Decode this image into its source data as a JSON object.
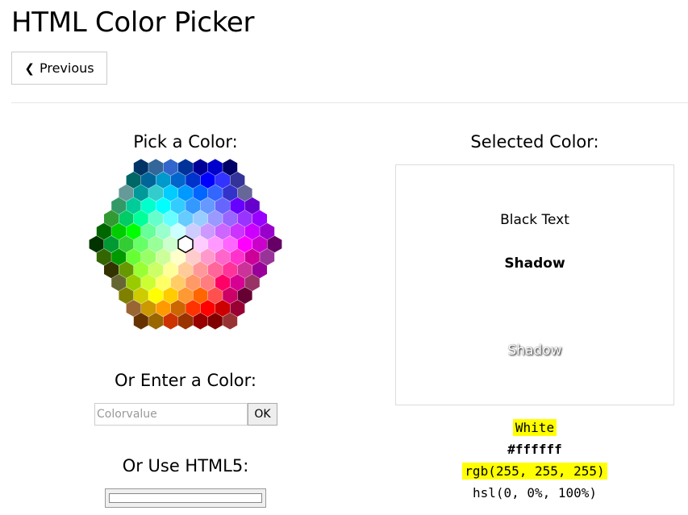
{
  "title": "HTML Color Picker",
  "nav": {
    "previous_label": "Previous"
  },
  "picker_section": {
    "heading": "Pick a Color:"
  },
  "enter_section": {
    "heading": "Or Enter a Color:",
    "placeholder": "Colorvalue",
    "ok_label": "OK"
  },
  "html5_section": {
    "heading": "Or Use HTML5:",
    "value": "#ffffff"
  },
  "selected_section": {
    "heading": "Selected Color:",
    "preview_bg": "#ffffff",
    "black_text": "Black Text",
    "shadow_label": "Shadow",
    "shadow_label_2": "Shadow"
  },
  "color_info": {
    "name": "White",
    "hex": "#ffffff",
    "rgb": "rgb(255, 255, 255)",
    "hsl": "hsl(0, 0%, 100%)",
    "highlight_color": "#ffff00"
  },
  "hex_palette": {
    "rows": [
      [
        "#003366",
        "#336699",
        "#3366CC",
        "#003399",
        "#000099",
        "#0000CC",
        "#000066"
      ],
      [
        "#006666",
        "#006699",
        "#0099CC",
        "#0066CC",
        "#0033CC",
        "#0000FF",
        "#3333FF",
        "#333399"
      ],
      [
        "#669999",
        "#009999",
        "#33CCCC",
        "#00CCFF",
        "#0099FF",
        "#0066FF",
        "#3366FF",
        "#3333CC",
        "#666699"
      ],
      [
        "#339966",
        "#00CC99",
        "#00FFCC",
        "#00FFFF",
        "#33CCFF",
        "#3399FF",
        "#6699FF",
        "#6666FF",
        "#6600FF",
        "#6600CC"
      ],
      [
        "#339933",
        "#00CC66",
        "#00FF99",
        "#66FFCC",
        "#66FFFF",
        "#66CCFF",
        "#99CCFF",
        "#9999FF",
        "#9966FF",
        "#9933FF",
        "#9900FF"
      ],
      [
        "#006600",
        "#00CC00",
        "#00FF00",
        "#66FF99",
        "#99FFCC",
        "#CCFFFF",
        "#CCCCFF",
        "#CC99FF",
        "#CC66FF",
        "#CC33FF",
        "#CC00FF",
        "#9900CC"
      ],
      [
        "#003300",
        "#009933",
        "#33CC33",
        "#66FF66",
        "#99FF99",
        "#CCFFCC",
        "#FFFFFF",
        "#FFCCFF",
        "#FF99FF",
        "#FF66FF",
        "#FF00FF",
        "#CC00CC",
        "#660066"
      ],
      [
        "#336600",
        "#009900",
        "#66FF33",
        "#99FF66",
        "#CCFF99",
        "#FFFFCC",
        "#FFCCCC",
        "#FF99CC",
        "#FF66CC",
        "#FF33CC",
        "#CC0099",
        "#993399"
      ],
      [
        "#333300",
        "#669900",
        "#99FF33",
        "#CCFF66",
        "#FFFF99",
        "#FFCC99",
        "#FF9999",
        "#FF6699",
        "#FF3399",
        "#CC3399",
        "#990099"
      ],
      [
        "#666633",
        "#99CC00",
        "#CCFF33",
        "#FFFF66",
        "#FFCC66",
        "#FF9966",
        "#FF7C80",
        "#FF0066",
        "#D60093",
        "#993366"
      ],
      [
        "#808000",
        "#CCCC00",
        "#FFFF00",
        "#FFCC00",
        "#FF9933",
        "#FF6600",
        "#FF5050",
        "#CC0066",
        "#660033"
      ],
      [
        "#996633",
        "#CC9900",
        "#FF9900",
        "#CC6600",
        "#FF3300",
        "#FF0000",
        "#CC0000",
        "#990033"
      ],
      [
        "#663300",
        "#996600",
        "#CC3300",
        "#993300",
        "#990000",
        "#800000",
        "#993333"
      ]
    ],
    "selected": "#FFFFFF"
  }
}
